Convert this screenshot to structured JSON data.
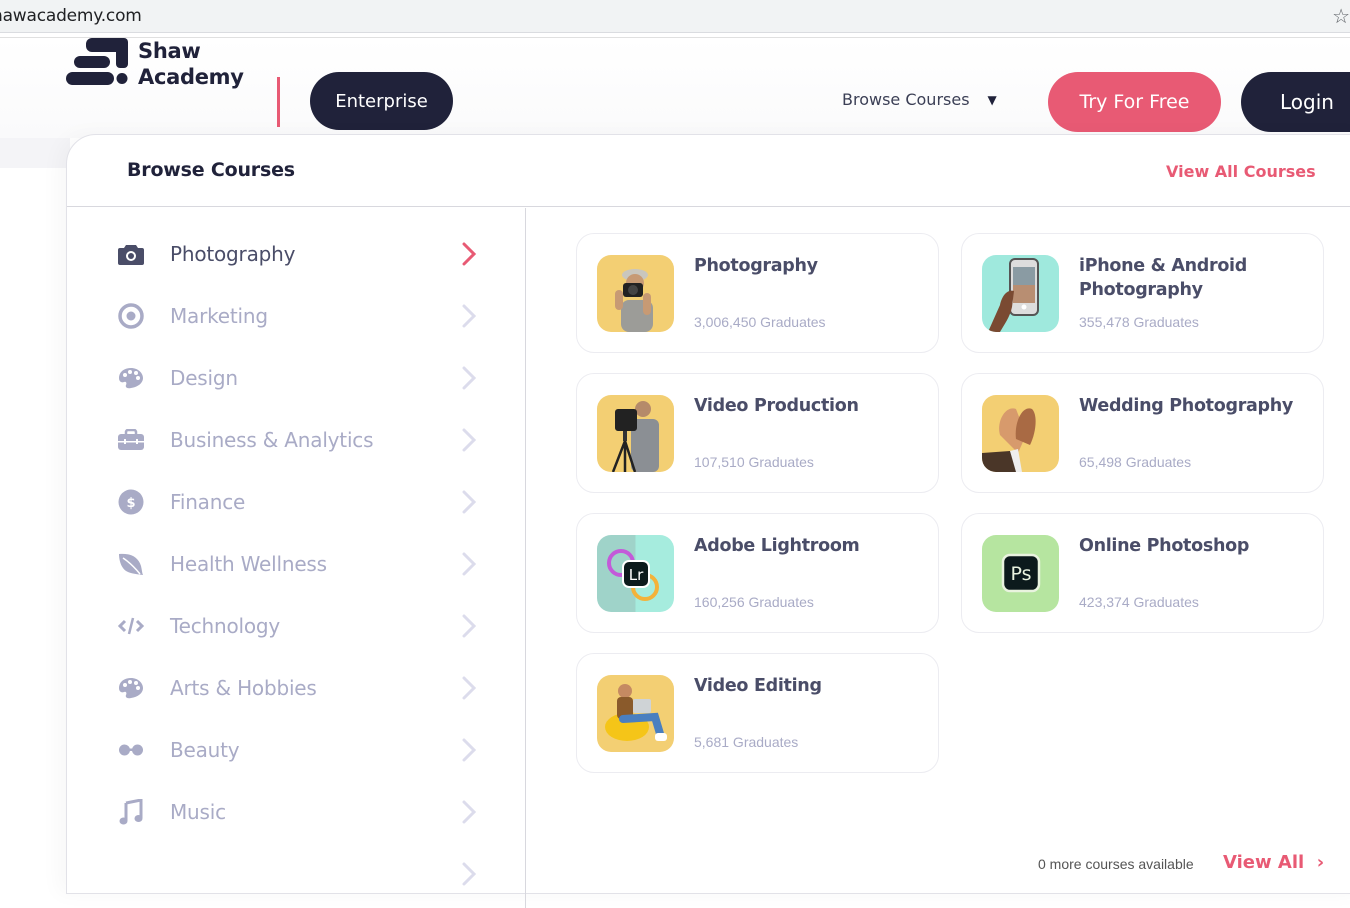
{
  "browser": {
    "url": "hawacademy.com",
    "bookmark_icon": "star-icon"
  },
  "header": {
    "logo_line1": "Shaw",
    "logo_line2": "Academy",
    "enterprise_label": "Enterprise",
    "browse_courses_label": "Browse Courses",
    "try_free_label": "Try For Free",
    "login_label": "Login"
  },
  "colors": {
    "brand_dark": "#20223a",
    "accent_pink": "#e85a74",
    "muted_text": "#a9abc6",
    "active_text": "#4a4d68"
  },
  "panel": {
    "title": "Browse Courses",
    "view_all_courses": "View All Courses"
  },
  "categories": [
    {
      "label": "Photography",
      "icon": "camera-icon",
      "active": true
    },
    {
      "label": "Marketing",
      "icon": "target-icon",
      "active": false
    },
    {
      "label": "Design",
      "icon": "palette-icon",
      "active": false
    },
    {
      "label": "Business & Analytics",
      "icon": "briefcase-icon",
      "active": false
    },
    {
      "label": "Finance",
      "icon": "dollar-icon",
      "active": false
    },
    {
      "label": "Health Wellness",
      "icon": "leaf-icon",
      "active": false
    },
    {
      "label": "Technology",
      "icon": "code-icon",
      "active": false
    },
    {
      "label": "Arts & Hobbies",
      "icon": "palette-icon",
      "active": false
    },
    {
      "label": "Beauty",
      "icon": "glasses-icon",
      "active": false
    },
    {
      "label": "Music",
      "icon": "music-note-icon",
      "active": false
    }
  ],
  "courses": [
    {
      "title": "Photography",
      "graduates": "3,006,450 Graduates",
      "thumb": "photographer-image",
      "bg": "#f3cf73"
    },
    {
      "title": "iPhone & Android Photography",
      "graduates": "355,478 Graduates",
      "thumb": "phone-camera-image",
      "bg": "#9fe9dd"
    },
    {
      "title": "Video Production",
      "graduates": "107,510 Graduates",
      "thumb": "videographer-image",
      "bg": "#f3cf73"
    },
    {
      "title": "Wedding Photography",
      "graduates": "65,498 Graduates",
      "thumb": "wedding-hands-image",
      "bg": "#f3cf73"
    },
    {
      "title": "Adobe Lightroom",
      "graduates": "160,256 Graduates",
      "thumb": "lightroom-logo",
      "bg": "#a6ecde"
    },
    {
      "title": "Online Photoshop",
      "graduates": "423,374 Graduates",
      "thumb": "photoshop-logo",
      "bg": "#b6e5a0"
    },
    {
      "title": "Video Editing",
      "graduates": "5,681 Graduates",
      "thumb": "video-editor-image",
      "bg": "#f3cf73"
    }
  ],
  "footer": {
    "more_courses": "0 more courses available",
    "view_all": "View All"
  }
}
